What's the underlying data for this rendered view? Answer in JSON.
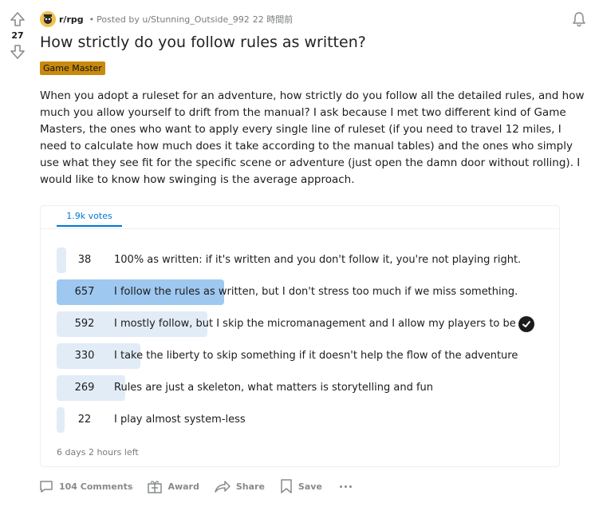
{
  "post": {
    "vote_count": "27",
    "subreddit": "r/rpg",
    "posted_by": "Posted by u/Stunning_Outside_992",
    "time": "22 時間前",
    "separator": "•",
    "title": "How strictly do you follow rules as written?",
    "flair": "Game Master",
    "body": "When you adopt a ruleset for an adventure, how strictly do you follow all the detailed rules, and how much you allow yourself to drift from the manual? I ask because I met two different kind of Game Masters, the ones who want to apply every single line of ruleset (if you need to travel 12 miles, I need to calculate how much does it take according to the manual tables) and the ones who simply use what they see fit for the specific scene or adventure (just open the damn door without rolling). I would like to know how swinging is the average approach."
  },
  "poll": {
    "tab_label": "1.9k votes",
    "options": [
      {
        "votes": "38",
        "label": "100% as written: if it's written and you don't follow it, you're not playing right.",
        "fraction": 0.0578,
        "selected": false
      },
      {
        "votes": "657",
        "label": "I follow the rules as written, but I don't stress too much if we miss something.",
        "fraction": 1.0,
        "selected": true
      },
      {
        "votes": "592",
        "label": "I mostly follow, but I skip the micromanagement and I allow my players to be ...",
        "fraction": 0.901,
        "selected": false
      },
      {
        "votes": "330",
        "label": "I take the liberty to skip something if it doesn't help the flow of the adventure",
        "fraction": 0.502,
        "selected": false
      },
      {
        "votes": "269",
        "label": "Rules are just a skeleton, what matters is storytelling and fun",
        "fraction": 0.409,
        "selected": false
      },
      {
        "votes": "22",
        "label": "I play almost system-less",
        "fraction": 0.0335,
        "selected": false
      }
    ],
    "time_left": "6 days 2 hours left"
  },
  "actions": {
    "comments": "104 Comments",
    "award": "Award",
    "share": "Share",
    "save": "Save"
  },
  "colors": {
    "flair_bg": "#c88a0d",
    "poll_bar": "#e1ecf7",
    "poll_bar_selected": "#9ec8f0",
    "accent": "#0079d3"
  },
  "icons": {
    "upvote": "upvote-arrow-icon",
    "downvote": "downvote-arrow-icon",
    "bell": "bell-icon",
    "comments": "comment-bubble-icon",
    "award": "gift-icon",
    "share": "share-arrow-icon",
    "save": "bookmark-icon",
    "more": "more-dots-icon",
    "check": "checkmark-icon"
  }
}
